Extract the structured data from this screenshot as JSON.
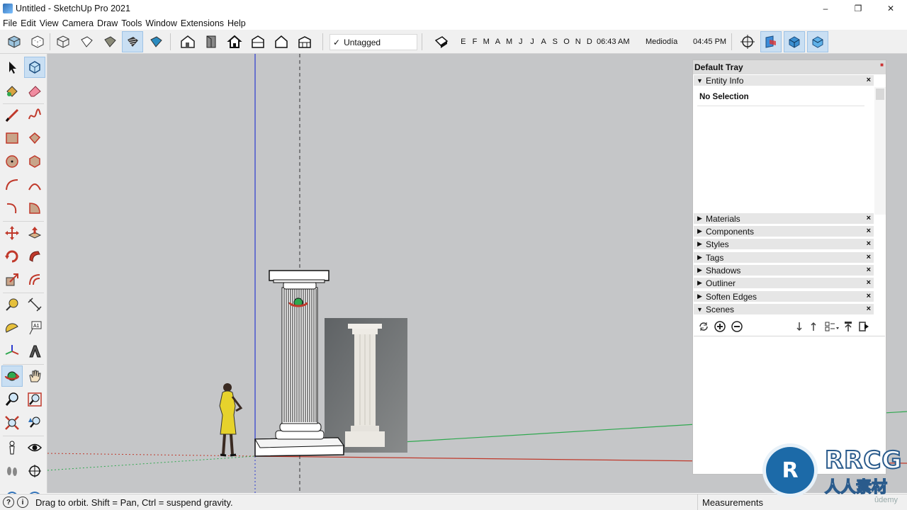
{
  "window": {
    "title": "Untitled - SketchUp Pro 2021",
    "controls": [
      "–",
      "❐",
      "✕"
    ]
  },
  "menu": [
    "File",
    "Edit",
    "View",
    "Camera",
    "Draw",
    "Tools",
    "Window",
    "Extensions",
    "Help"
  ],
  "toolbar": {
    "tag_selector": {
      "check": "✓",
      "value": "Untagged"
    },
    "shadow": {
      "months": [
        "E",
        "F",
        "M",
        "A",
        "M",
        "J",
        "J",
        "A",
        "S",
        "O",
        "N",
        "D"
      ],
      "time_start": "06:43 AM",
      "time_mid": "Mediodía",
      "time_end": "04:45 PM"
    }
  },
  "left_toolbar": {
    "icons": [
      "select-icon",
      "make-component-icon",
      "paint-bucket-icon",
      "eraser-icon",
      "line-icon",
      "freehand-icon",
      "rectangle-icon",
      "rotated-rectangle-icon",
      "circle-icon",
      "polygon-icon",
      "arc-icon",
      "two-point-arc-icon",
      "three-point-arc-icon",
      "pie-icon",
      "move-icon",
      "push-pull-icon",
      "rotate-icon",
      "follow-me-icon",
      "scale-icon",
      "offset-icon",
      "tape-measure-icon",
      "dimension-icon",
      "protractor-icon",
      "text-icon",
      "axes-icon",
      "3d-text-icon",
      "orbit-icon",
      "pan-icon",
      "zoom-icon",
      "zoom-window-icon",
      "zoom-extents-icon",
      "previous-view-icon",
      "position-camera-icon",
      "look-around-icon",
      "walk-icon",
      "section-plane-icon"
    ],
    "active": "orbit-icon"
  },
  "tray": {
    "title": "Default Tray",
    "entity_info": {
      "label": "Entity Info",
      "content": "No Selection"
    },
    "panels": [
      "Materials",
      "Components",
      "Styles",
      "Tags",
      "Shadows",
      "Outliner",
      "Soften Edges"
    ],
    "scenes": {
      "label": "Scenes"
    },
    "close_glyph": "×"
  },
  "status": {
    "message": "Drag to orbit. Shift = Pan, Ctrl = suspend gravity.",
    "measurements_label": "Measurements"
  },
  "watermark": {
    "logo": "R",
    "line1": "RRCG",
    "line2": "人人素材",
    "udemy": "ûdemy"
  },
  "colors": {
    "viewport_bg": "#c5c6c8",
    "axis_red": "#c0392b",
    "axis_green": "#2fa84f",
    "axis_blue": "#2b3bd0",
    "selection_blue": "#c9dff3"
  }
}
